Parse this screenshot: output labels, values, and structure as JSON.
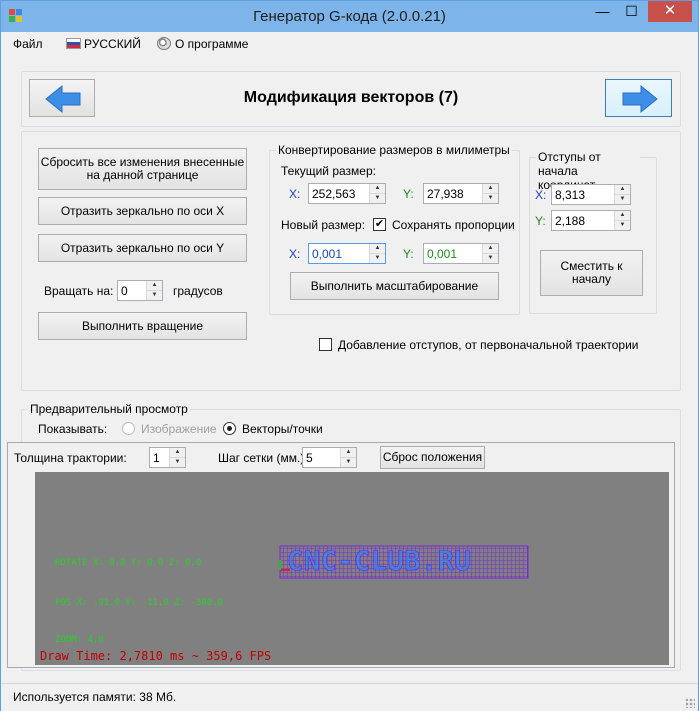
{
  "window": {
    "title": "Генератор G-кода (2.0.0.21)",
    "minimize": "—",
    "maximize": "☐",
    "close": "✕"
  },
  "menu": {
    "file": "Файл",
    "language": "РУССКИЙ",
    "about": "О программе"
  },
  "header": {
    "title": "Модификация векторов (7)",
    "back_icon": "arrow-left-icon",
    "forward_icon": "arrow-right-icon",
    "arrow_color": "#3d8ee6"
  },
  "actions": {
    "reset": "Сбросить все изменения внесенные на данной странице",
    "mirror_x": "Отразить зеркально по оси X",
    "mirror_y": "Отразить зеркально по оси Y",
    "rotate_label": "Вращать на:",
    "rotate_value": "0",
    "rotate_unit": "градусов",
    "rotate_button": "Выполнить вращение"
  },
  "size": {
    "group_title": "Конвертирование размеров в милиметры",
    "current_label": "Текущий размер:",
    "x_label": "X:",
    "y_label": "Y:",
    "current_x": "252,563",
    "current_y": "27,938",
    "new_label": "Новый размер:",
    "keep_ratio": "Сохранять пропорции",
    "new_x": "0,001",
    "new_y": "0,001",
    "scale_button": "Выполнить масштабирование"
  },
  "offset": {
    "group_title": "Отступы от начала координат",
    "x_label": "X:",
    "y_label": "Y:",
    "x_value": "8,313",
    "y_value": "2,188",
    "move_button": "Сместить к началу"
  },
  "add_offsets": "Добавление отступов, от первоначальной траектории",
  "preview": {
    "group_title": "Предварительный просмотр",
    "show_label": "Показывать:",
    "option_image": "Изображение",
    "option_vectors": "Векторы/точки",
    "thickness_label": "Толщина трактории:",
    "thickness_value": "1",
    "grid_label": "Шаг сетки (мм.):",
    "grid_value": "5",
    "reset_button": "Сброс положения",
    "canvas": {
      "rotate": "ROTATE X: 0,0  Y: 0,0 Z: 0,0",
      "pos": "POS X: -91,0  Y: -11,0 Z: -300,0",
      "zoom": "ZOOM: 4,0",
      "draw_time": "Draw Time: 2,7810 ms ~ 359,6 FPS",
      "preview_text": "CNC-CLUB.RU",
      "background": "#808080",
      "grid_color": "#7a2bd9"
    }
  },
  "status": {
    "memory": "Используется памяти:  38  Мб."
  }
}
